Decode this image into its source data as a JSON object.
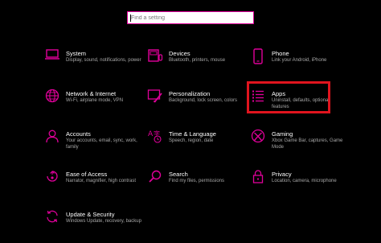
{
  "search": {
    "placeholder": "Find a setting"
  },
  "colors": {
    "accent": "#e0009a",
    "highlight": "#e0141e",
    "background": "#000000"
  },
  "tiles": [
    {
      "title": "System",
      "desc": "Display, sound, notifications, power",
      "icon": "laptop-icon"
    },
    {
      "title": "Devices",
      "desc": "Bluetooth, printers, mouse",
      "icon": "devices-icon"
    },
    {
      "title": "Phone",
      "desc": "Link your Android, iPhone",
      "icon": "phone-icon"
    },
    {
      "title": "Network & Internet",
      "desc": "Wi-Fi, airplane mode, VPN",
      "icon": "globe-icon"
    },
    {
      "title": "Personalization",
      "desc": "Background, lock screen, colors",
      "icon": "paintbrush-icon"
    },
    {
      "title": "Apps",
      "desc": "Uninstall, defaults, optional features",
      "icon": "apps-list-icon"
    },
    {
      "title": "Accounts",
      "desc": "Your accounts, email, sync, work, family",
      "icon": "person-icon"
    },
    {
      "title": "Time & Language",
      "desc": "Speech, region, date",
      "icon": "time-language-icon"
    },
    {
      "title": "Gaming",
      "desc": "Xbox Game Bar, captures, Game Mode",
      "icon": "xbox-icon"
    },
    {
      "title": "Ease of Access",
      "desc": "Narrator, magnifier, high contrast",
      "icon": "ease-of-access-icon"
    },
    {
      "title": "Search",
      "desc": "Find my files, permissions",
      "icon": "search-icon"
    },
    {
      "title": "Privacy",
      "desc": "Location, camera, microphone",
      "icon": "lock-icon"
    },
    {
      "title": "Update & Security",
      "desc": "Windows Update, recovery, backup",
      "icon": "sync-icon"
    }
  ]
}
